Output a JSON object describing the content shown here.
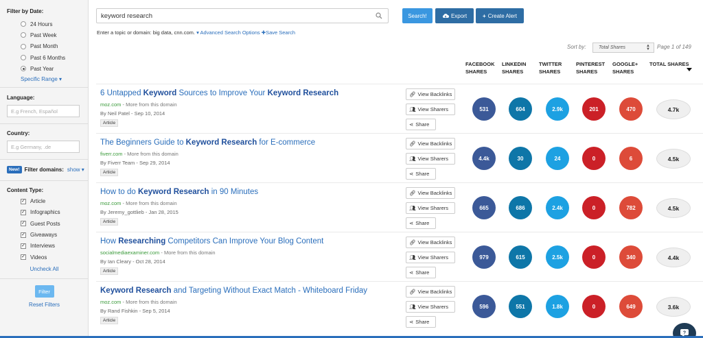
{
  "sidebar": {
    "date_title": "Filter by Date:",
    "date_options": [
      {
        "label": "24 Hours",
        "selected": false
      },
      {
        "label": "Past Week",
        "selected": false
      },
      {
        "label": "Past Month",
        "selected": false
      },
      {
        "label": "Past 6 Months",
        "selected": false
      },
      {
        "label": "Past Year",
        "selected": true
      }
    ],
    "specific_range": "Specific Range",
    "language_title": "Language:",
    "language_placeholder": "E.g French, Español",
    "country_title": "Country:",
    "country_placeholder": "E.g Germany, .de",
    "new_badge": "New!",
    "filter_domains": "Filter domains:",
    "show_link": "show",
    "content_title": "Content Type:",
    "content_types": [
      {
        "label": "Article",
        "checked": true
      },
      {
        "label": "Infographics",
        "checked": true
      },
      {
        "label": "Guest Posts",
        "checked": true
      },
      {
        "label": "Giveaways",
        "checked": true
      },
      {
        "label": "Interviews",
        "checked": true
      },
      {
        "label": "Videos",
        "checked": true
      }
    ],
    "uncheck_all": "Uncheck All",
    "filter_button": "Filter",
    "reset_filters": "Reset Filters"
  },
  "search": {
    "query": "keyword research",
    "search_button": "Search!",
    "export_button": "Export",
    "create_alert_button": "Create Alert",
    "hint": "Enter a topic or domain: big data, cnn.com.",
    "advanced_link": "Advanced Search Options",
    "save_link": "Save Search"
  },
  "sort": {
    "label": "Sort by:",
    "selected": "Total Shares",
    "page_info": "Page 1 of 149"
  },
  "columns": {
    "facebook": [
      "FACEBOOK",
      "SHARES"
    ],
    "linkedin": [
      "LINKEDIN",
      "SHARES"
    ],
    "twitter": [
      "TWITTER",
      "SHARES"
    ],
    "pinterest": [
      "PINTEREST",
      "SHARES"
    ],
    "google": [
      "GOOGLE+",
      "SHARES"
    ],
    "total": "TOTAL SHARES"
  },
  "actions": {
    "backlinks": "View Backlinks",
    "sharers": "View Sharers",
    "share": "Share"
  },
  "colors": {
    "facebook": "#3b5998",
    "linkedin": "#0e76a8",
    "twitter": "#1da1e2",
    "pinterest": "#cb2027",
    "google": "#dd4b39",
    "link": "#2a6ebb",
    "domain": "#3a9a3a"
  },
  "results": [
    {
      "title_parts": [
        [
          "6 Untapped ",
          false
        ],
        [
          "Keyword",
          true
        ],
        [
          " Sources to Improve Your ",
          false
        ],
        [
          "Keyword Research",
          true
        ]
      ],
      "domain": "moz.com",
      "more": " - More from this domain",
      "author": "By Neil Patel - Sep 10, 2014",
      "tag": "Article",
      "facebook": "531",
      "linkedin": "604",
      "twitter": "2.9k",
      "pinterest": "201",
      "google": "470",
      "total": "4.7k"
    },
    {
      "title_parts": [
        [
          "The Beginners Guide to ",
          false
        ],
        [
          "Keyword Research",
          true
        ],
        [
          " for E-commerce",
          false
        ]
      ],
      "domain": "fiverr.com",
      "more": " - More from this domain",
      "author": "By Fiverr Team - Sep 29, 2014",
      "tag": "Article",
      "facebook": "4.4k",
      "linkedin": "30",
      "twitter": "24",
      "pinterest": "0",
      "google": "6",
      "total": "4.5k"
    },
    {
      "title_parts": [
        [
          "How to do ",
          false
        ],
        [
          "Keyword Research",
          true
        ],
        [
          " in 90 Minutes",
          false
        ]
      ],
      "domain": "moz.com",
      "more": " - More from this domain",
      "author": "By Jeremy_gottlieb - Jan 28, 2015",
      "tag": "Article",
      "facebook": "665",
      "linkedin": "686",
      "twitter": "2.4k",
      "pinterest": "0",
      "google": "782",
      "total": "4.5k"
    },
    {
      "title_parts": [
        [
          "How ",
          false
        ],
        [
          "Researching",
          true
        ],
        [
          " Competitors Can Improve Your Blog Content",
          false
        ]
      ],
      "domain": "socialmediaexaminer.com",
      "more": " - More from this domain",
      "author": "By Ian Cleary - Oct 28, 2014",
      "tag": "Article",
      "facebook": "979",
      "linkedin": "615",
      "twitter": "2.5k",
      "pinterest": "0",
      "google": "340",
      "total": "4.4k"
    },
    {
      "title_parts": [
        [
          "Keyword Research",
          true
        ],
        [
          " and Targeting Without Exact Match - Whiteboard Friday",
          false
        ]
      ],
      "domain": "moz.com",
      "more": " - More from this domain",
      "author": "By Rand Fishkin - Sep 5, 2014",
      "tag": "Article",
      "facebook": "596",
      "linkedin": "551",
      "twitter": "1.8k",
      "pinterest": "0",
      "google": "649",
      "total": "3.6k"
    }
  ]
}
